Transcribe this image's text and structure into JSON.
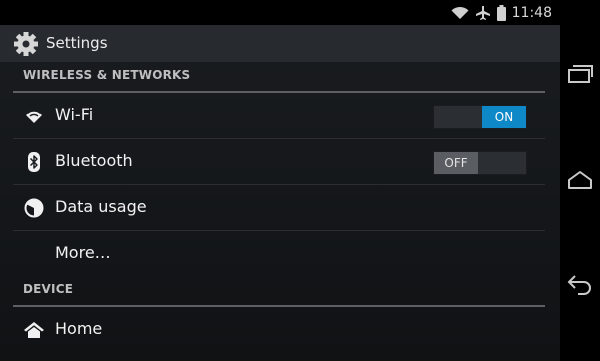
{
  "status_bar": {
    "time": "11:48",
    "icons": [
      "wifi-icon",
      "airplane-icon",
      "battery-icon"
    ]
  },
  "action_bar": {
    "title": "Settings",
    "icon": "gear-icon"
  },
  "sections": {
    "wireless": {
      "header": "WIRELESS & NETWORKS",
      "items": [
        {
          "label": "Wi-Fi",
          "icon": "wifi-icon",
          "toggle": "ON"
        },
        {
          "label": "Bluetooth",
          "icon": "bluetooth-icon",
          "toggle": "OFF"
        },
        {
          "label": "Data usage",
          "icon": "data-usage-icon"
        },
        {
          "label": "More…"
        }
      ]
    },
    "device": {
      "header": "DEVICE",
      "items": [
        {
          "label": "Home",
          "icon": "home-icon"
        }
      ]
    }
  },
  "nav_bar": {
    "buttons": [
      "recent-apps-icon",
      "home-icon",
      "back-icon"
    ]
  },
  "colors": {
    "accent": "#0e88c7",
    "background": "#15181b",
    "action_bar": "#272b30"
  }
}
